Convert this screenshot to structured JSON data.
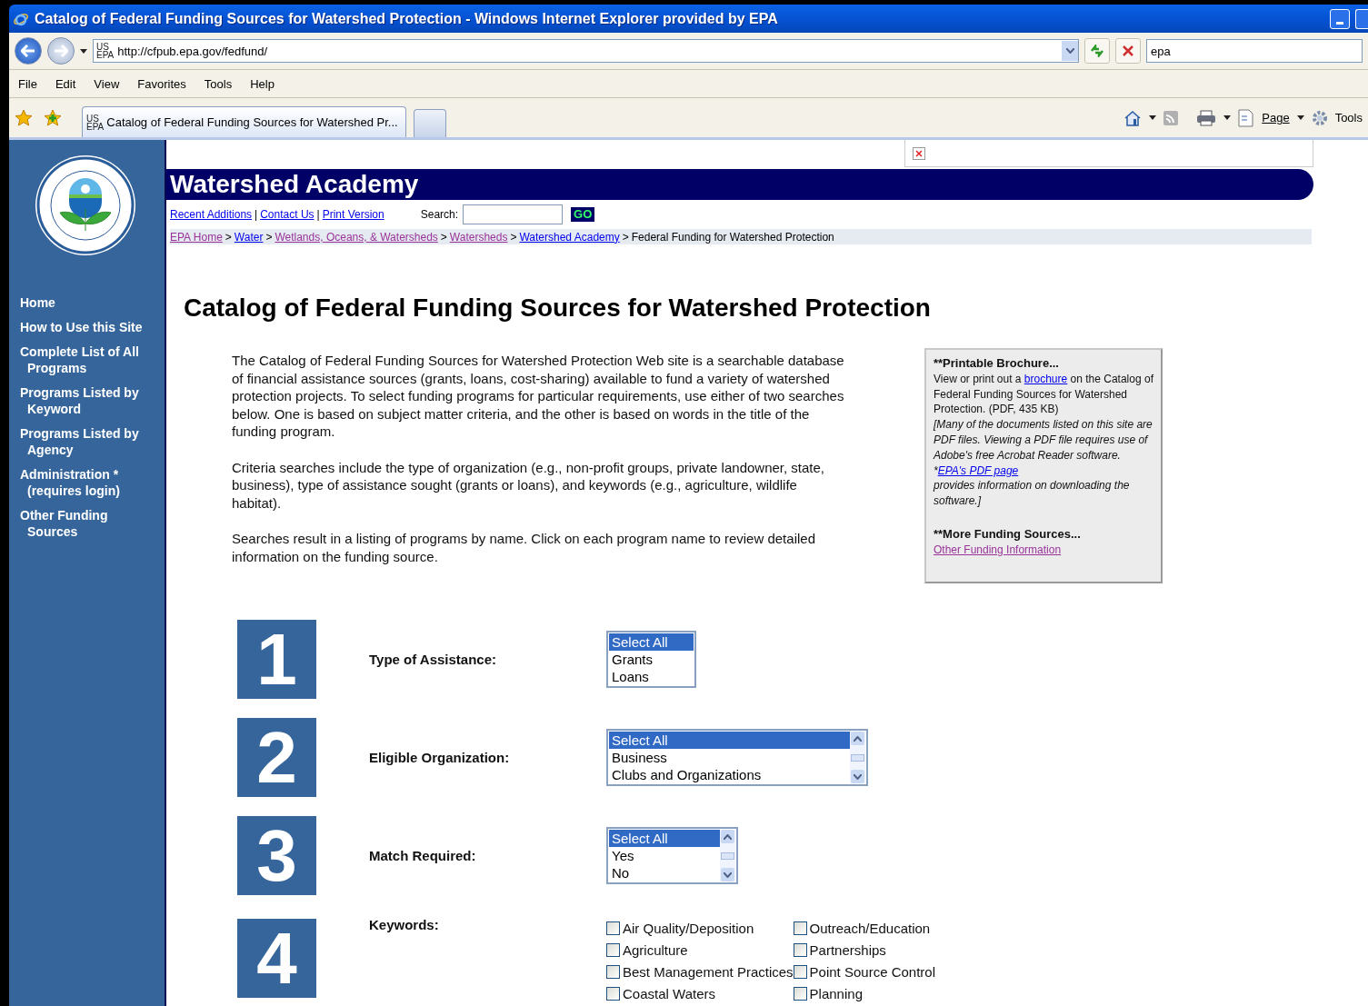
{
  "window": {
    "title": "Catalog of Federal Funding Sources for Watershed Protection - Windows Internet Explorer provided by EPA",
    "address": "http://cfpub.epa.gov/fedfund/",
    "address_badge": "US\nEPA",
    "search_value": "epa"
  },
  "menu": [
    "File",
    "Edit",
    "View",
    "Favorites",
    "Tools",
    "Help"
  ],
  "tab": {
    "badge": "US\nEPA",
    "title": "Catalog of Federal Funding Sources for Watershed Pr..."
  },
  "command_bar": {
    "page": "Page",
    "tools": "Tools"
  },
  "sidebar": {
    "items": [
      "Home",
      "How to Use this Site",
      "Complete List of All\nPrograms",
      "Programs Listed by\nKeyword",
      "Programs Listed by\nAgency",
      "Administration *\n(requires login)",
      "Other Funding\nSources"
    ]
  },
  "banner": {
    "title": "Watershed Academy"
  },
  "utility_links": [
    "Recent Additions",
    "Contact Us",
    "Print Version"
  ],
  "utility_separator": "|",
  "search": {
    "label": "Search:",
    "button": "GO"
  },
  "breadcrumb_separator": ">",
  "breadcrumb": [
    {
      "text": "EPA Home",
      "link": true,
      "visited": true
    },
    {
      "text": "Water",
      "link": true,
      "visited": false
    },
    {
      "text": "Wetlands, Oceans, & Watersheds",
      "link": true,
      "visited": true
    },
    {
      "text": "Watersheds",
      "link": true,
      "visited": true
    },
    {
      "text": "Watershed Academy",
      "link": true,
      "visited": false
    },
    {
      "text": "Federal Funding for Watershed Protection",
      "link": false,
      "visited": false
    }
  ],
  "heading": "Catalog of Federal Funding Sources for Watershed Protection",
  "paragraphs": [
    "The Catalog of Federal Funding Sources for Watershed Protection Web site is a searchable database of financial assistance sources (grants, loans, cost-sharing) available to fund a variety of watershed protection projects. To select funding programs for particular requirements, use either of two searches below. One is based on subject matter criteria, and the other is based on words in the title of the funding program.",
    "Criteria searches include the type of organization (e.g., non-profit groups, private landowner, state, business), type of assistance sought (grants or loans), and keywords (e.g., agriculture, wildlife habitat).",
    "Searches result in a listing of programs by name. Click on each program name to review detailed information on the funding source."
  ],
  "sidebox": {
    "brochure_heading": "**Printable Brochure...",
    "brochure_before": "View or print out a",
    "brochure_link": "brochure",
    "brochure_after": "on the Catalog of Federal Funding Sources for Watershed Protection. (PDF, 435 KB)",
    "note_before": "[Many of the documents listed on this site are PDF files. Viewing a PDF file requires use of Adobe's free Acrobat Reader software.  *",
    "note_link": "EPA's PDF page",
    "note_after": " provides information on downloading the software.]",
    "more_heading": "**More Funding Sources...",
    "more_link": "Other Funding Information"
  },
  "steps": [
    {
      "number": "1",
      "label": "Type of Assistance:",
      "kind": "listbox",
      "scrollable": false,
      "options": [
        {
          "text": "Select All",
          "selected": true
        },
        {
          "text": "Grants",
          "selected": false
        },
        {
          "text": "Loans",
          "selected": false
        }
      ]
    },
    {
      "number": "2",
      "label": "Eligible Organization:",
      "kind": "listbox",
      "scrollable": true,
      "options": [
        {
          "text": "Select All",
          "selected": true
        },
        {
          "text": "Business",
          "selected": false
        },
        {
          "text": "Clubs and Organizations",
          "selected": false
        }
      ]
    },
    {
      "number": "3",
      "label": "Match Required:",
      "kind": "listbox",
      "scrollable": true,
      "options": [
        {
          "text": "Select All",
          "selected": true
        },
        {
          "text": "Yes",
          "selected": false
        },
        {
          "text": "No",
          "selected": false
        }
      ]
    },
    {
      "number": "4",
      "label": "Keywords:",
      "kind": "checkboxes",
      "items": [
        {
          "label": "Air Quality/Deposition",
          "checked": false
        },
        {
          "label": "Outreach/Education",
          "checked": false
        },
        {
          "label": "Agriculture",
          "checked": false
        },
        {
          "label": "Partnerships",
          "checked": false
        },
        {
          "label": "Best Management Practices",
          "checked": false
        },
        {
          "label": "Point Source Control",
          "checked": false
        },
        {
          "label": "Coastal Waters",
          "checked": false
        },
        {
          "label": "Planning",
          "checked": false
        }
      ]
    }
  ]
}
